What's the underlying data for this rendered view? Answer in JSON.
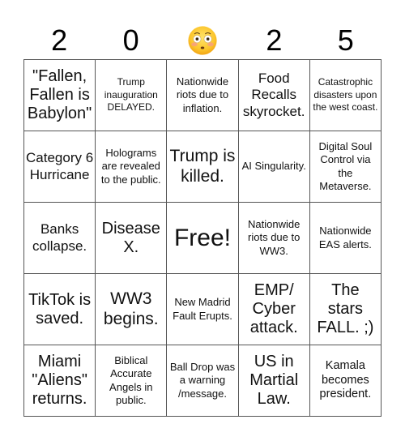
{
  "header": {
    "letters": [
      {
        "text": "2"
      },
      {
        "text": "0"
      },
      {
        "text": "",
        "icon": "flushed-face-emoji"
      },
      {
        "text": "2"
      },
      {
        "text": "5"
      }
    ]
  },
  "grid": {
    "rows": [
      [
        {
          "text": "\"Fallen, Fallen is Babylon\"",
          "size": "l"
        },
        {
          "text": "Trump inauguration DELAYED.",
          "size": "xxs"
        },
        {
          "text": "Nationwide riots due to inflation.",
          "size": "xs"
        },
        {
          "text": "Food Recalls skyrocket.",
          "size": "m"
        },
        {
          "text": "Catastrophic disasters upon the west coast.",
          "size": "xxs"
        }
      ],
      [
        {
          "text": "Category 6 Hurricane",
          "size": "m"
        },
        {
          "text": "Holograms are revealed to the public.",
          "size": "xs"
        },
        {
          "text": "Trump is killed.",
          "size": "l2"
        },
        {
          "text": "AI Singularity.",
          "size": "xs"
        },
        {
          "text": "Digital Soul Control via the Metaverse.",
          "size": "xs"
        }
      ],
      [
        {
          "text": "Banks collapse.",
          "size": "m"
        },
        {
          "text": "Disease X.",
          "size": "l"
        },
        {
          "text": "Free!",
          "size": "xl",
          "free": true
        },
        {
          "text": "Nationwide riots due to WW3.",
          "size": "xs"
        },
        {
          "text": "Nationwide EAS alerts.",
          "size": "xs"
        }
      ],
      [
        {
          "text": "TikTok is saved.",
          "size": "l"
        },
        {
          "text": "WW3 begins.",
          "size": "l2"
        },
        {
          "text": "New Madrid Fault Erupts.",
          "size": "xs"
        },
        {
          "text": "EMP/ Cyber attack.",
          "size": "l"
        },
        {
          "text": "The stars FALL. ;)",
          "size": "l"
        }
      ],
      [
        {
          "text": "Miami \"Aliens\" returns.",
          "size": "l"
        },
        {
          "text": "Biblical Accurate Angels in public.",
          "size": "xs"
        },
        {
          "text": "Ball Drop was a warning /message.",
          "size": "xs"
        },
        {
          "text": "US in Martial Law.",
          "size": "l"
        },
        {
          "text": "Kamala becomes president.",
          "size": "s"
        }
      ]
    ]
  }
}
